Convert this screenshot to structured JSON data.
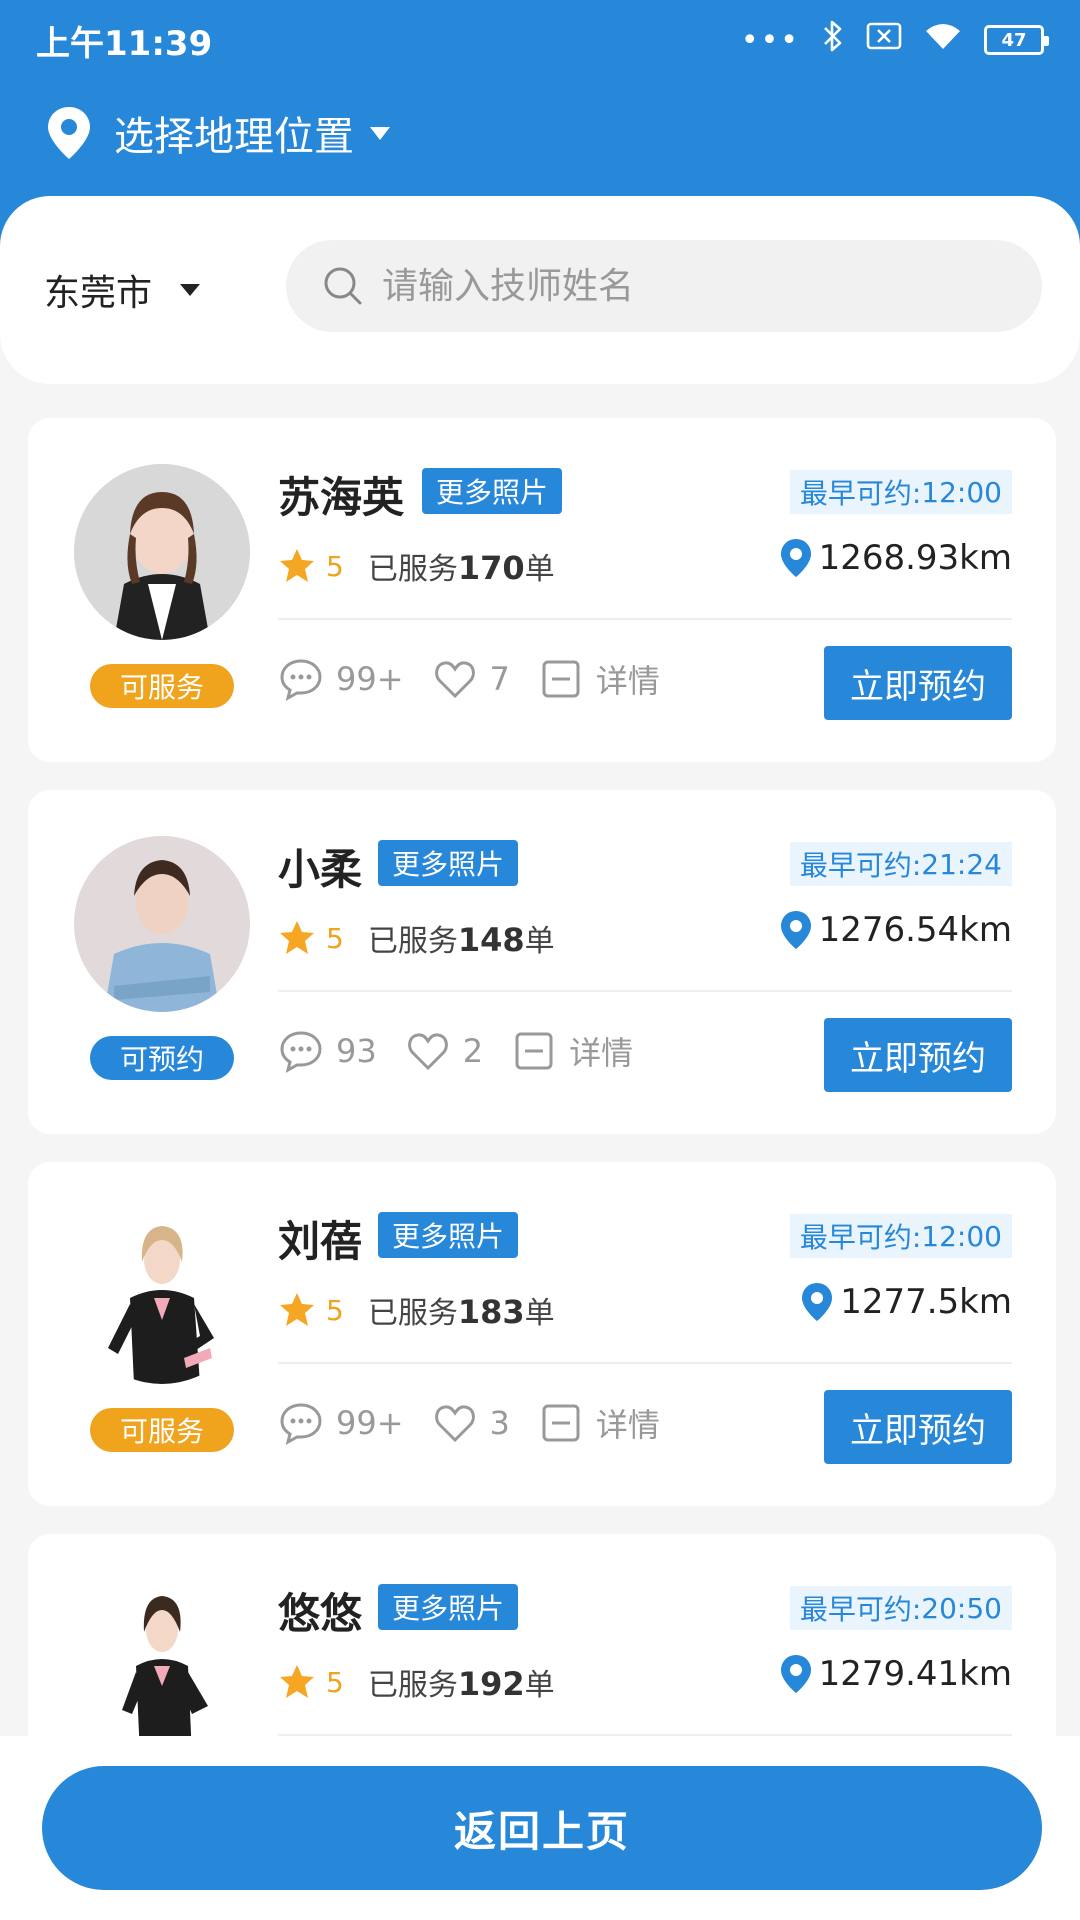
{
  "status_bar": {
    "time": "上午11:39",
    "battery": "47"
  },
  "header": {
    "location_title": "选择地理位置"
  },
  "search": {
    "city": "东莞市",
    "placeholder": "请输入技师姓名"
  },
  "common": {
    "more_photos": "更多照片",
    "book_now": "立即预约",
    "detail": "详情",
    "earliest_prefix": "最早可约:"
  },
  "technicians": [
    {
      "name": "苏海英",
      "status": "可服务",
      "earliest": "12:00",
      "rating": "5",
      "served_prefix": "已服务",
      "served_count": "170",
      "served_suffix": "单",
      "distance": "1268.93km",
      "comments": "99+",
      "likes": "7"
    },
    {
      "name": "小柔",
      "status": "可预约",
      "earliest": "21:24",
      "rating": "5",
      "served_prefix": "已服务",
      "served_count": "148",
      "served_suffix": "单",
      "distance": "1276.54km",
      "comments": "93",
      "likes": "2"
    },
    {
      "name": "刘蓓",
      "status": "可服务",
      "earliest": "12:00",
      "rating": "5",
      "served_prefix": "已服务",
      "served_count": "183",
      "served_suffix": "单",
      "distance": "1277.5km",
      "comments": "99+",
      "likes": "3"
    },
    {
      "name": "悠悠",
      "status": "",
      "earliest": "20:50",
      "rating": "5",
      "served_prefix": "已服务",
      "served_count": "192",
      "served_suffix": "单",
      "distance": "1279.41km",
      "comments": "",
      "likes": ""
    }
  ],
  "footer": {
    "back_label": "返回上页"
  },
  "colors": {
    "brand_blue": "#2787d8",
    "status_orange": "#f0a31c"
  }
}
